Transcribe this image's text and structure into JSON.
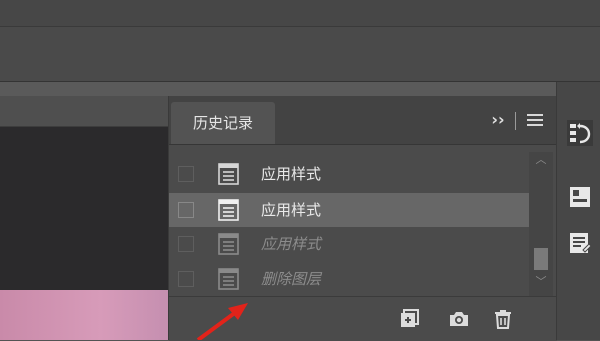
{
  "history_panel": {
    "tab_label": "历史记录",
    "collapse_icon": "double-chevron-right-icon",
    "menu_icon": "hamburger-menu-icon",
    "rows": [
      {
        "label": "应用样式",
        "state": "normal"
      },
      {
        "label": "应用样式",
        "state": "selected"
      },
      {
        "label": "应用样式",
        "state": "undone"
      },
      {
        "label": "删除图层",
        "state": "undone"
      }
    ],
    "footer_buttons": [
      "new-document-from-state-icon",
      "camera-snapshot-icon",
      "trash-icon"
    ]
  },
  "right_dock": {
    "buttons": [
      "history-brush-icon",
      "panel-layout-icon",
      "document-edit-icon"
    ]
  },
  "colors": {
    "panel_bg": "#4b4b4b",
    "selected_row": "#676767",
    "annotation_arrow": "#e2231a"
  }
}
